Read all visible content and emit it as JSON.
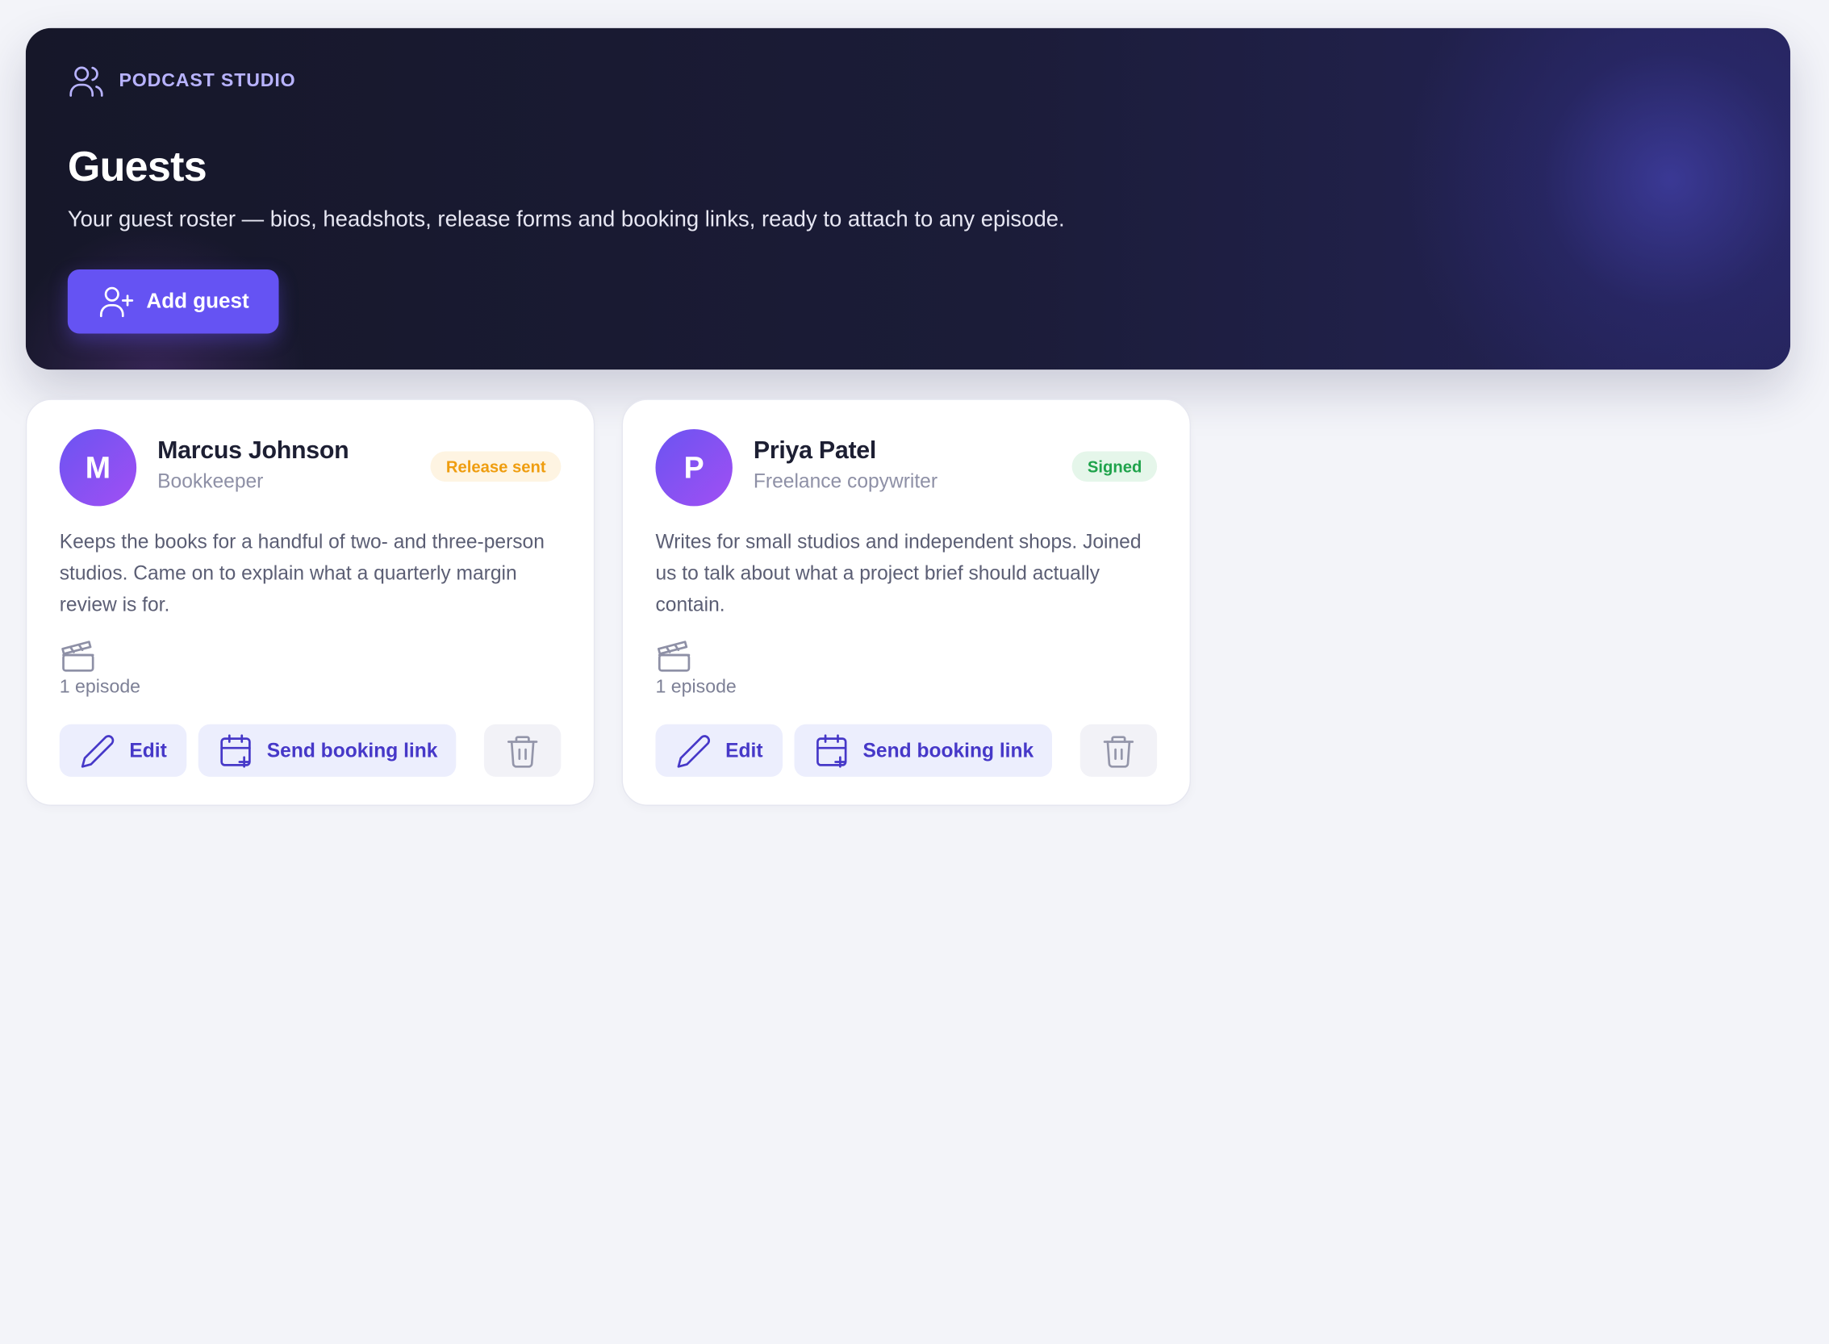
{
  "header": {
    "eyebrow_icon": "users-icon",
    "eyebrow": "PODCAST STUDIO",
    "title": "Guests",
    "subtitle": "Your guest roster — bios, headshots, release forms and booking links, ready to attach to any episode.",
    "add_button": "Add guest",
    "add_button_icon": "user-plus-icon",
    "colors": {
      "hero_bg": "#161729",
      "accent": "#6553f3",
      "eyebrow": "#b8b3ff"
    }
  },
  "guests": [
    {
      "initial": "M",
      "name": "Marcus Johnson",
      "role": "Bookkeeper",
      "status": "Release sent",
      "status_color": "#ef9d0f",
      "bio": "Keeps the books for a handful of two- and three-person studios. Came on to explain what a quarterly margin review is for.",
      "episodes": "1 episode",
      "actions": {
        "edit": "Edit",
        "booking": "Send booking link"
      }
    },
    {
      "initial": "P",
      "name": "Priya Patel",
      "role": "Freelance copywriter",
      "status": "Signed",
      "status_color": "#1fa34b",
      "bio": "Writes for small studios and independent shops. Joined us to talk about what a project brief should actually contain.",
      "episodes": "1 episode",
      "actions": {
        "edit": "Edit",
        "booking": "Send booking link"
      }
    }
  ]
}
